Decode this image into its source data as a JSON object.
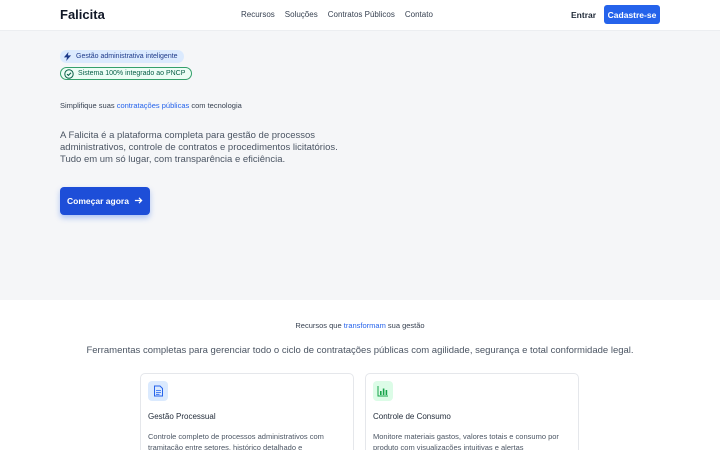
{
  "header": {
    "brand": "Falicita",
    "nav": [
      "Recursos",
      "Soluções",
      "Contratos Públicos",
      "Contato"
    ],
    "login": "Entrar",
    "signup": "Cadastre-se"
  },
  "hero": {
    "badge1": {
      "icon": "lightning-icon",
      "text": "Gestão administrativa inteligente"
    },
    "badge2": {
      "icon": "check-circle-icon",
      "text": "Sistema 100% integrado ao PNCP"
    },
    "tagline": {
      "before": "Simplifique suas ",
      "highlight": "contratações públicas",
      "after": " com tecnologia"
    },
    "description": "A Falicita é a plataforma completa para gestão de processos administrativos, controle de contratos e procedimentos licitatórios. Tudo em um só lugar, com transparência e eficiência.",
    "cta": "Começar agora"
  },
  "features": {
    "title": {
      "before": "Recursos que ",
      "highlight": "transformam",
      "after": " sua gestão"
    },
    "subtitle": "Ferramentas completas para gerenciar todo o ciclo de contratações públicas com agilidade, segurança e total conformidade legal.",
    "cards": [
      {
        "icon": "document-icon",
        "title": "Gestão Processual",
        "description": "Controle completo de processos administrativos com tramitação entre setores, histórico detalhado e"
      },
      {
        "icon": "bar-chart-icon",
        "title": "Controle de Consumo",
        "description": "Monitore materiais gastos, valores totais e consumo por produto com visualizações intuitivas e alertas"
      }
    ]
  },
  "colors": {
    "accent": "#2563eb",
    "hero_bg": "#f5f6f8",
    "success": "#065f46"
  }
}
